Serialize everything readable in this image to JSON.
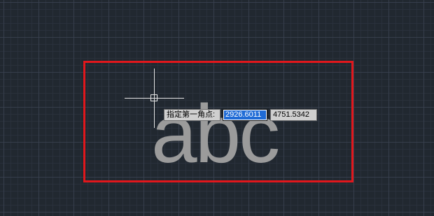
{
  "drawing": {
    "text": "abc"
  },
  "dynamic_input": {
    "prompt": "指定第一角点:",
    "x_value": "2926.6011",
    "y_value": "4751.5342"
  },
  "colors": {
    "background": "#212830",
    "highlight": "#e1171c",
    "text_entity": "#9b9b9b",
    "selection": "#1f6bd6"
  },
  "icons": {
    "cursor": "crosshair-cursor-icon"
  }
}
